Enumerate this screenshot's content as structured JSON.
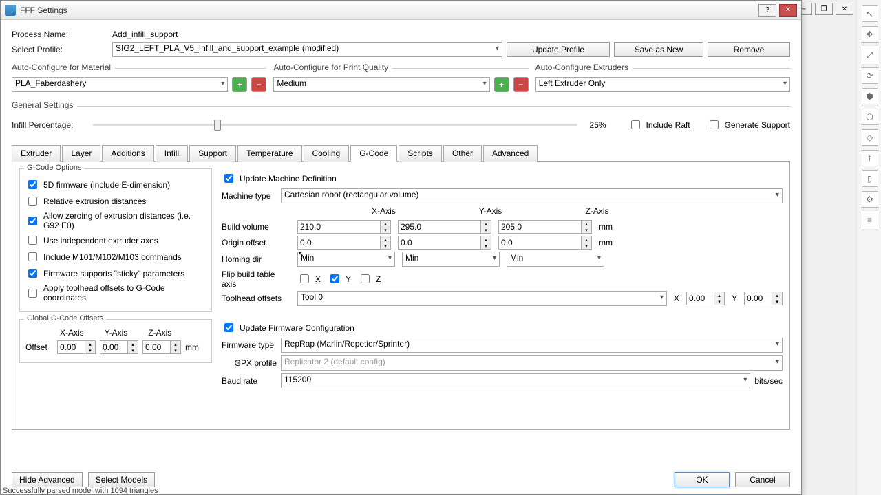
{
  "window": {
    "title": "FFF Settings"
  },
  "top_right_winbtns": [
    "─",
    "❐",
    "✕"
  ],
  "header": {
    "process_name_label": "Process Name:",
    "process_name": "Add_infill_support",
    "select_profile_label": "Select Profile:",
    "select_profile": "SIG2_LEFT_PLA_V5_Infill_and_support_example (modified)",
    "update_profile": "Update Profile",
    "save_as_new": "Save as New",
    "remove": "Remove"
  },
  "auto": {
    "material_label": "Auto-Configure for Material",
    "material": "PLA_Faberdashery",
    "quality_label": "Auto-Configure for Print Quality",
    "quality": "Medium",
    "extruders_label": "Auto-Configure Extruders",
    "extruders": "Left Extruder Only"
  },
  "general": {
    "title": "General Settings",
    "infill_label": "Infill Percentage:",
    "infill_pct": "25%",
    "include_raft": "Include Raft",
    "generate_support": "Generate Support"
  },
  "tabs": [
    "Extruder",
    "Layer",
    "Additions",
    "Infill",
    "Support",
    "Temperature",
    "Cooling",
    "G-Code",
    "Scripts",
    "Other",
    "Advanced"
  ],
  "gcode_options": {
    "title": "G-Code Options",
    "opts": [
      {
        "label": "5D firmware (include E-dimension)",
        "checked": true
      },
      {
        "label": "Relative extrusion distances",
        "checked": false
      },
      {
        "label": "Allow zeroing of extrusion distances (i.e. G92 E0)",
        "checked": true
      },
      {
        "label": "Use independent extruder axes",
        "checked": false
      },
      {
        "label": "Include M101/M102/M103 commands",
        "checked": false
      },
      {
        "label": "Firmware supports \"sticky\" parameters",
        "checked": true
      },
      {
        "label": "Apply toolhead offsets to G-Code coordinates",
        "checked": false
      }
    ]
  },
  "global_offsets": {
    "title": "Global G-Code Offsets",
    "offset_label": "Offset",
    "x_label": "X-Axis",
    "y_label": "Y-Axis",
    "z_label": "Z-Axis",
    "x": "0.00",
    "y": "0.00",
    "z": "0.00",
    "unit": "mm"
  },
  "machine": {
    "update_def": "Update Machine Definition",
    "type_label": "Machine type",
    "type": "Cartesian robot (rectangular volume)",
    "x_label": "X-Axis",
    "y_label": "Y-Axis",
    "z_label": "Z-Axis",
    "build_label": "Build volume",
    "build_x": "210.0",
    "build_y": "295.0",
    "build_z": "205.0",
    "origin_label": "Origin offset",
    "origin_x": "0.0",
    "origin_y": "0.0",
    "origin_z": "0.0",
    "homing_label": "Homing dir",
    "homing_x": "Min",
    "homing_y": "Min",
    "homing_z": "Min",
    "flip_label": "Flip build table axis",
    "flip_x": "X",
    "flip_y": "Y",
    "flip_z": "Z",
    "flip_x_checked": false,
    "flip_y_checked": true,
    "flip_z_checked": false,
    "toolhead_label": "Toolhead offsets",
    "toolhead": "Tool 0",
    "tool_x_label": "X",
    "tool_x": "0.00",
    "tool_y_label": "Y",
    "tool_y": "0.00",
    "unit": "mm"
  },
  "firmware": {
    "update_label": "Update Firmware Configuration",
    "type_label": "Firmware type",
    "type": "RepRap (Marlin/Repetier/Sprinter)",
    "gpx_label": "GPX profile",
    "gpx": "Replicator 2 (default config)",
    "baud_label": "Baud rate",
    "baud": "115200",
    "baud_unit": "bits/sec"
  },
  "buttons": {
    "hide_advanced": "Hide Advanced",
    "select_models": "Select Models",
    "ok": "OK",
    "cancel": "Cancel"
  },
  "status": "Successfully parsed model with 1094 triangles",
  "side_icons": [
    "↖",
    "✥",
    "⤢",
    "⟳",
    "⬢",
    "⬡",
    "◇",
    "⤒",
    "▯",
    "⚙",
    "≡"
  ]
}
